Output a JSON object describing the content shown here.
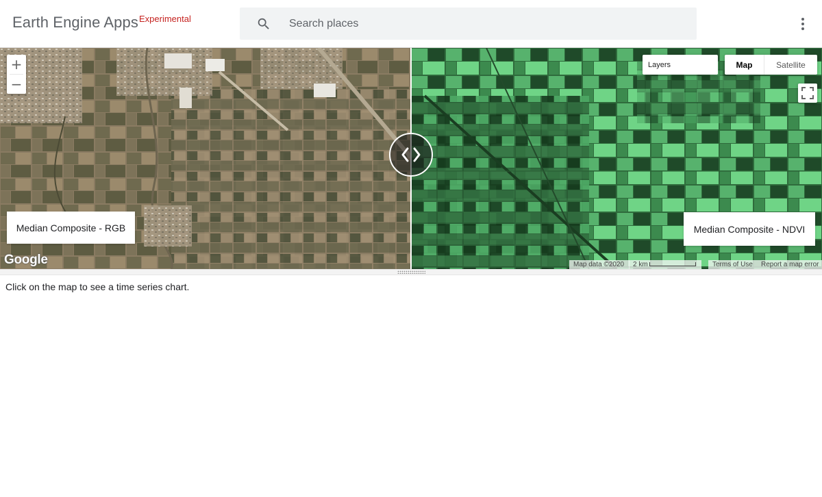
{
  "header": {
    "brand": "Earth Engine Apps",
    "badge": "Experimental",
    "search_placeholder": "Search places",
    "search_icon": "search-icon",
    "menu_icon": "more-vert-icon"
  },
  "map": {
    "zoom_in": "+",
    "zoom_out": "−",
    "layers_label": "Layers",
    "maptype": {
      "selected": "Map",
      "options": [
        "Map",
        "Satellite"
      ]
    },
    "left_layer_label": "Median Composite - RGB",
    "right_layer_label": "Median Composite - NDVI",
    "google_logo": "Google",
    "attribution": "Map data ©2020",
    "scale_label": "2 km",
    "terms": "Terms of Use",
    "report": "Report a map error",
    "colors": {
      "rgb_base": "#8a7b62",
      "ndvi_base": "#2f6b3c",
      "ndvi_bright": "#6fd486"
    }
  },
  "panel": {
    "message": "Click on the map to see a time series chart."
  }
}
